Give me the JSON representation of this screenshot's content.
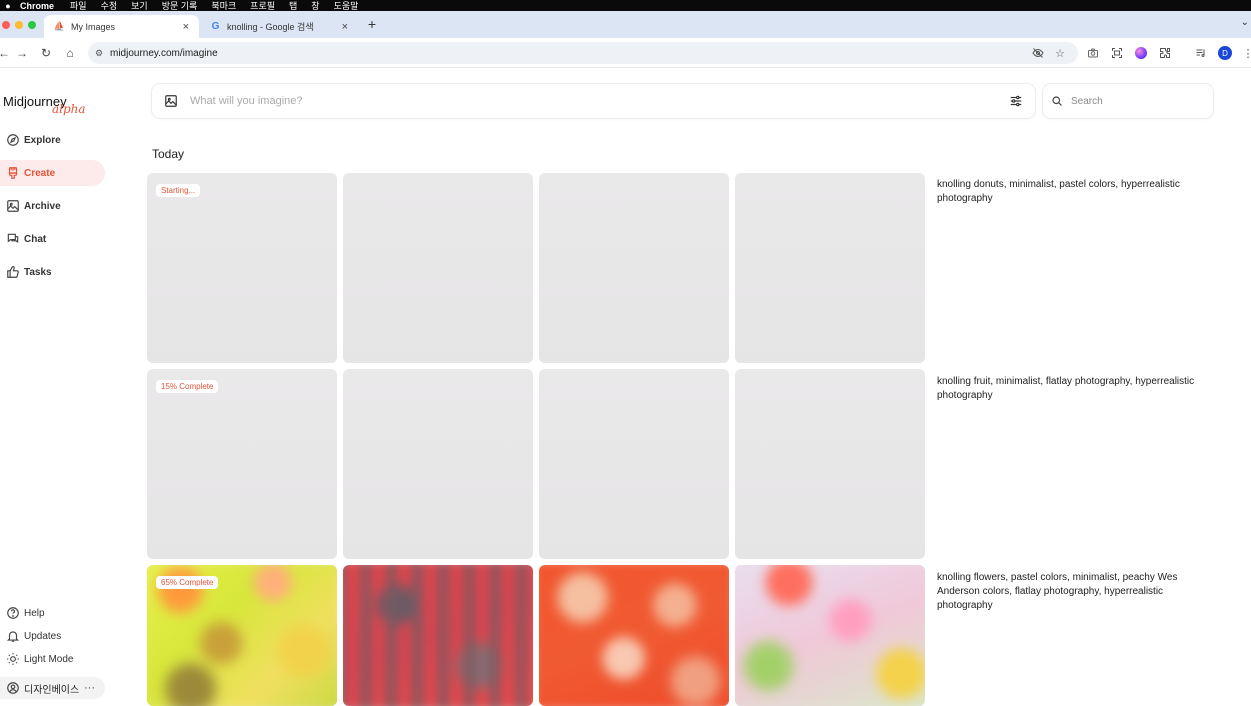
{
  "os_menubar": {
    "apple": "",
    "app_name": "Chrome",
    "items": [
      "파일",
      "수정",
      "보기",
      "방문 기록",
      "북마크",
      "프로필",
      "탭",
      "창",
      "도움말"
    ]
  },
  "browser": {
    "tabs": [
      {
        "title": "My Images",
        "close": "×",
        "active": true
      },
      {
        "title": "knolling - Google 검색",
        "close": "×",
        "active": false
      }
    ],
    "new_tab": "+",
    "url": "midjourney.com/imagine",
    "profile_initial": "D"
  },
  "sidebar": {
    "logo": "Midjourney",
    "logo_tag": "alpha",
    "nav": [
      {
        "label": "Explore",
        "icon": "compass-icon"
      },
      {
        "label": "Create",
        "icon": "brush-icon",
        "selected": true
      },
      {
        "label": "Archive",
        "icon": "image-icon"
      },
      {
        "label": "Chat",
        "icon": "chat-icon"
      },
      {
        "label": "Tasks",
        "icon": "thumbs-up-icon"
      }
    ],
    "bottom": [
      {
        "label": "Help",
        "icon": "help-icon"
      },
      {
        "label": "Updates",
        "icon": "bell-icon"
      },
      {
        "label": "Light Mode",
        "icon": "sun-icon"
      }
    ],
    "user": {
      "name": "디자인베이스",
      "more": "···"
    }
  },
  "main": {
    "prompt_placeholder": "What will you imagine?",
    "search_placeholder": "Search",
    "section_title": "Today",
    "rows": [
      {
        "status": "Starting...",
        "prompt": "knolling donuts, minimalist, pastel colors, hyperrealistic photography"
      },
      {
        "status": "15% Complete",
        "prompt": "knolling fruit, minimalist, flatlay photography, hyperrealistic photography"
      },
      {
        "status": "65% Complete",
        "prompt": "knolling flowers, pastel colors, minimalist, peachy Wes Anderson colors, flatlay photography, hyperrealistic photography"
      }
    ]
  },
  "colors": {
    "accent": "#e2553b",
    "selected_bg": "#fdeaea",
    "placeholder_tile": "#e9e8e9"
  }
}
